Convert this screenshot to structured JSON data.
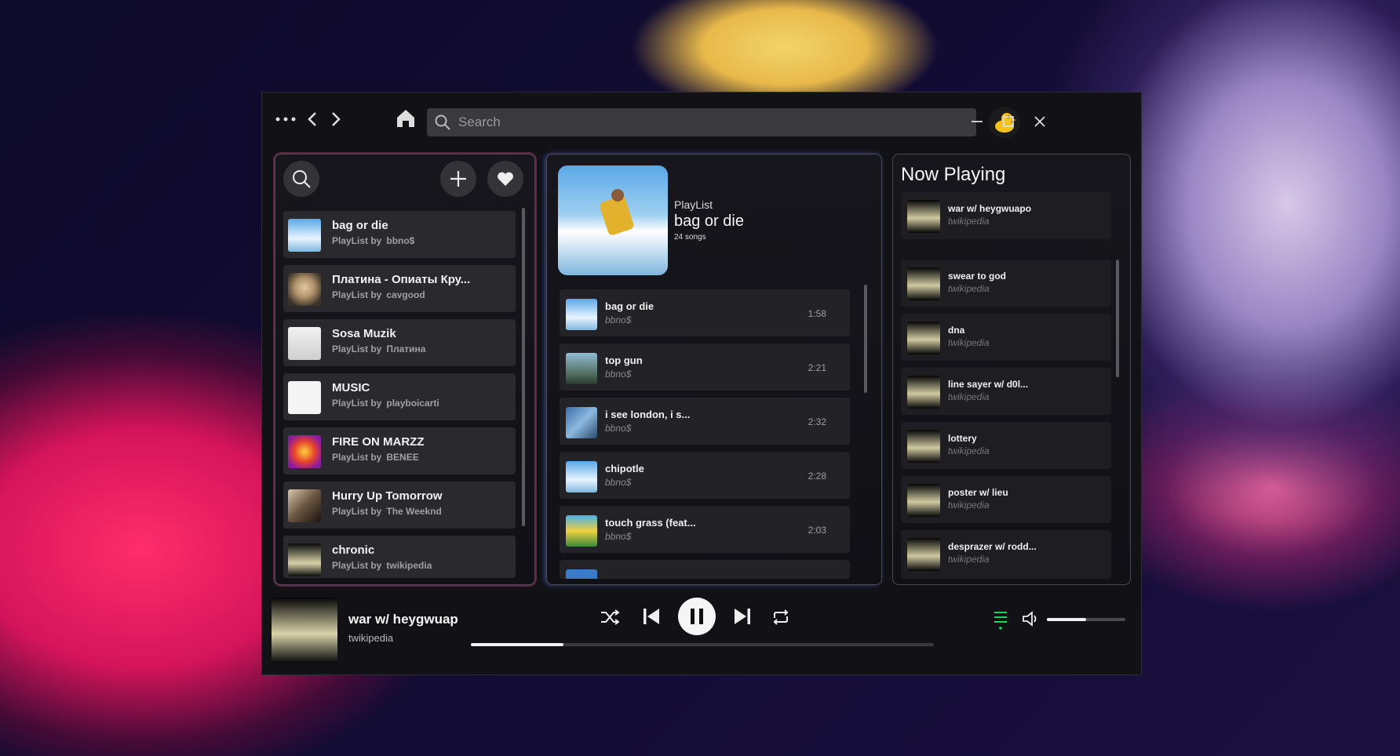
{
  "colors": {
    "accent_green": "#1ed760",
    "brand_pink": "#e65096"
  },
  "titlebar": {
    "search_placeholder": "Search",
    "icons": [
      "more-icon",
      "back-icon",
      "forward-icon",
      "home-icon",
      "search-icon",
      "avatar-duck",
      "minimize-icon",
      "maximize-icon",
      "close-icon"
    ]
  },
  "library": {
    "items": [
      {
        "title": "bag or die",
        "by_label": "PlayList by",
        "owner": "bbno$"
      },
      {
        "title": "Платина - Опиаты Кру...",
        "by_label": "PlayList by",
        "owner": "cavgood"
      },
      {
        "title": "Sosa Muzik",
        "by_label": "PlayList by",
        "owner": "Платина"
      },
      {
        "title": "MUSIC",
        "by_label": "PlayList by",
        "owner": "playboicarti"
      },
      {
        "title": "FIRE ON MARZZ",
        "by_label": "PlayList by",
        "owner": "BENEE"
      },
      {
        "title": "Hurry Up Tomorrow",
        "by_label": "PlayList by",
        "owner": "The Weeknd"
      },
      {
        "title": "chronic",
        "by_label": "PlayList by",
        "owner": "twikipedia"
      }
    ]
  },
  "playlist": {
    "type_label": "PlayList",
    "name": "bag or die",
    "song_count": "24 songs",
    "tracks": [
      {
        "title": "bag or die",
        "artist": "bbno$",
        "duration": "1:58"
      },
      {
        "title": "top gun",
        "artist": "bbno$",
        "duration": "2:21"
      },
      {
        "title": "i see london, i s...",
        "artist": "bbno$",
        "duration": "2:32"
      },
      {
        "title": "chipotle",
        "artist": "bbno$",
        "duration": "2:28"
      },
      {
        "title": "touch grass (feat...",
        "artist": "bbno$",
        "duration": "2:03"
      }
    ]
  },
  "now_playing_panel": {
    "heading": "Now Playing",
    "current": {
      "title": "war w/ heygwuapo",
      "artist": "twikipedia"
    },
    "queue": [
      {
        "title": "swear to god",
        "artist": "twikipedia"
      },
      {
        "title": "dna",
        "artist": "twikipedia"
      },
      {
        "title": "line sayer w/ d0l...",
        "artist": "twikipedia"
      },
      {
        "title": "lottery",
        "artist": "twikipedia"
      },
      {
        "title": "poster w/ lieu",
        "artist": "twikipedia"
      },
      {
        "title": "desprazer w/ rodd...",
        "artist": "twikipedia"
      }
    ]
  },
  "player": {
    "title": "war w/ heygwuap",
    "artist": "twikipedia",
    "progress": 0.2,
    "volume": 0.5,
    "state": "playing"
  }
}
